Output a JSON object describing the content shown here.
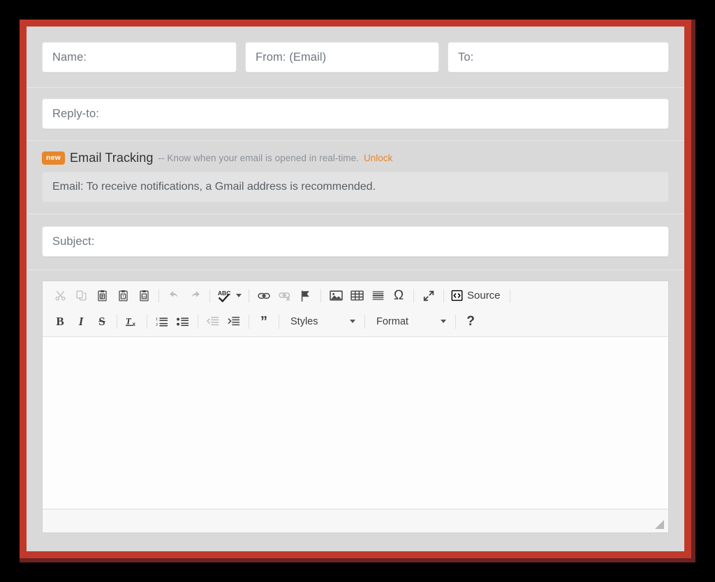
{
  "theme": {
    "frame_color": "#c0392b",
    "frame_shadow": "#6b2222",
    "page_bg": "#d9d9d9",
    "accent_orange": "#e8862a",
    "field_bg": "#ffffff",
    "note_bg": "#e3e3e3"
  },
  "fields": {
    "name": {
      "placeholder": "Name:",
      "value": ""
    },
    "from": {
      "placeholder": "From: (Email)",
      "value": ""
    },
    "to": {
      "placeholder": "To:",
      "value": ""
    },
    "reply_to": {
      "placeholder": "Reply-to:",
      "value": ""
    },
    "subject": {
      "placeholder": "Subject:",
      "value": ""
    }
  },
  "tracking": {
    "badge": "new",
    "title": "Email Tracking",
    "description": "-- Know when your email is opened in real-time.",
    "unlock_label": "Unlock",
    "note": "Email: To receive notifications, a Gmail address is recommended."
  },
  "editor": {
    "toolbar_row1": [
      {
        "name": "cut-icon",
        "label": "Cut",
        "state": "dim"
      },
      {
        "name": "copy-icon",
        "label": "Copy",
        "state": "dim"
      },
      {
        "name": "paste-icon",
        "label": "Paste",
        "state": "normal"
      },
      {
        "name": "paste-as-plain-text-icon",
        "label": "Paste as plain text",
        "state": "normal"
      },
      {
        "name": "paste-from-word-icon",
        "label": "Paste from Word",
        "state": "normal"
      },
      {
        "name": "undo-icon",
        "label": "Undo",
        "state": "dim"
      },
      {
        "name": "redo-icon",
        "label": "Redo",
        "state": "dim"
      },
      {
        "name": "spell-check-icon",
        "label": "ABC",
        "state": "normal"
      },
      {
        "name": "link-icon",
        "label": "Link",
        "state": "normal"
      },
      {
        "name": "unlink-icon",
        "label": "Unlink",
        "state": "dim"
      },
      {
        "name": "anchor-flag-icon",
        "label": "Anchor",
        "state": "normal"
      },
      {
        "name": "image-icon",
        "label": "Image",
        "state": "normal"
      },
      {
        "name": "table-icon",
        "label": "Table",
        "state": "normal"
      },
      {
        "name": "horizontal-rule-icon",
        "label": "Horizontal line",
        "state": "normal"
      },
      {
        "name": "special-character-icon",
        "label": "Ω",
        "state": "normal"
      },
      {
        "name": "maximize-icon",
        "label": "Maximize",
        "state": "normal"
      },
      {
        "name": "source-icon",
        "label": "Source",
        "state": "normal"
      }
    ],
    "source_label": "Source",
    "toolbar_row2": [
      {
        "name": "bold-button",
        "label": "B",
        "state": "normal"
      },
      {
        "name": "italic-button",
        "label": "I",
        "state": "normal"
      },
      {
        "name": "strikethrough-button",
        "label": "S",
        "state": "normal"
      },
      {
        "name": "remove-format-button",
        "label": "Tx",
        "state": "normal"
      },
      {
        "name": "numbered-list-button",
        "label": "Numbered list",
        "state": "normal"
      },
      {
        "name": "bulleted-list-button",
        "label": "Bulleted list",
        "state": "normal"
      },
      {
        "name": "outdent-button",
        "label": "Decrease indent",
        "state": "dim"
      },
      {
        "name": "indent-button",
        "label": "Increase indent",
        "state": "normal"
      },
      {
        "name": "blockquote-button",
        "label": "Block quote",
        "state": "normal"
      },
      {
        "name": "help-button",
        "label": "?",
        "state": "normal"
      }
    ],
    "styles_dropdown": {
      "label": "Styles",
      "selected": "Styles"
    },
    "format_dropdown": {
      "label": "Format",
      "selected": "Format"
    },
    "help_label": "?",
    "body_content": ""
  }
}
